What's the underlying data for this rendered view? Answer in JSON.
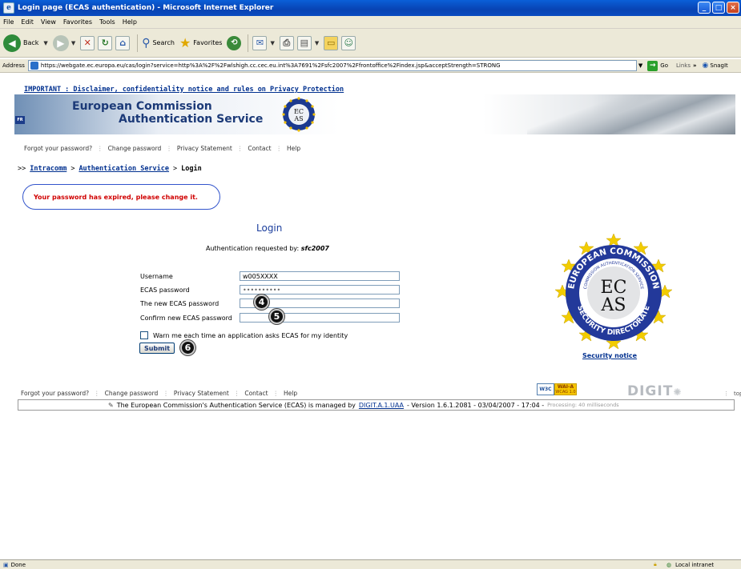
{
  "window": {
    "title": "Login page (ECAS authentication) - Microsoft Internet Explorer",
    "buttons": [
      "_",
      "□",
      "×"
    ]
  },
  "menu": [
    "File",
    "Edit",
    "View",
    "Favorites",
    "Tools",
    "Help"
  ],
  "toolbar": {
    "back": "Back",
    "search": "Search",
    "favorites": "Favorites"
  },
  "address": {
    "label": "Address",
    "url": "https://webgate.ec.europa.eu/cas/login?service=http%3A%2F%2Fwlshigh.cc.cec.eu.int%3A7691%2Fsfc2007%2Ffrontoffice%2Findex.jsp&acceptStrength=STRONG",
    "go": "Go",
    "links": "Links",
    "chevron": "»",
    "snagit": "SnagIt"
  },
  "page": {
    "important": "IMPORTANT : Disclaimer, confidentiality notice and rules on Privacy Protection",
    "banner": {
      "line1": "European Commission",
      "line2": "Authentication Service",
      "lang": "FR",
      "seal_top": "EC",
      "seal_bottom": "AS"
    },
    "topnav": [
      "Forgot your password?",
      "Change password",
      "Privacy Statement",
      "Contact",
      "Help"
    ],
    "breadcrumb": {
      "prefix": ">>",
      "items": [
        "Intracomm",
        "Authentication Service"
      ],
      "sep": ">",
      "current": "Login"
    },
    "error": "Your password has expired, please change it.",
    "login_title": "Login",
    "auth_requested_label": "Authentication requested by:",
    "auth_requested_value": "sfc2007",
    "fields": {
      "username": {
        "label": "Username",
        "value": "w005XXXX"
      },
      "password": {
        "label": "ECAS password",
        "value": "••••••••••"
      },
      "new_password": {
        "label": "The new ECAS password",
        "value": ""
      },
      "confirm_password": {
        "label": "Confirm new ECAS password",
        "value": ""
      }
    },
    "warn_label": "Warn me each time an application asks ECAS for my identity",
    "submit": "Submit",
    "callouts": [
      "4",
      "5",
      "6"
    ],
    "big_seal": {
      "ring_top": "EUROPEAN COMMISSION",
      "ring_bottom": "SECURITY DIRECTORATE",
      "inner_ring": "COMMISSION AUTHENTICATION SERVICE",
      "center_top": "EC",
      "center_bottom": "AS"
    },
    "security_notice": "Security notice",
    "footnav": [
      "Forgot your password?",
      "Change password",
      "Privacy Statement",
      "Contact",
      "Help"
    ],
    "wai": {
      "w3c": "W3C",
      "wai": "WAI-A",
      "wcag": "WCAG 1.0"
    },
    "digit": "DIGIT",
    "top": "top",
    "footer": {
      "text1": "The European Commission's Authentication Service (ECAS) is managed by",
      "link": "DIGIT.A.1.UAA",
      "text2": "- Version 1.6.1.2081 - 03/04/2007 - 17:04 -",
      "processing": "Processing: 40 milliseconds"
    }
  },
  "status": {
    "left": "Done",
    "right": "Local intranet"
  }
}
